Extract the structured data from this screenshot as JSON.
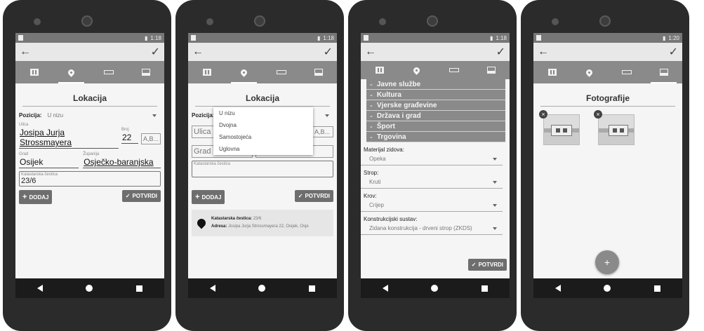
{
  "status": {
    "time1": "1:18",
    "time2": "1:18",
    "time3": "1:18",
    "time4": "1:20"
  },
  "icons": {
    "back": "←",
    "confirm": "✓"
  },
  "screen1": {
    "title": "Lokacija",
    "pozicija_label": "Pozicija:",
    "pozicija_value": "U nizu",
    "ulica_label": "Ulica",
    "broj_label": "Broj",
    "ulica_value": "Josipa Jurja Strossmayera",
    "broj_value": "22",
    "slovo_placeholder": "A,B...",
    "grad_label": "Grad",
    "zupanija_label": "Županija",
    "grad_value": "Osijek",
    "zupanija_value": "Osječko-baranjska",
    "katastarska_label": "Katastarska čestica",
    "katastarska_value": "23/6",
    "dodaj_label": "DODAJ",
    "potvrdi_label": "POTVRDI"
  },
  "screen2": {
    "title": "Lokacija",
    "pozicija_label": "Pozicija:",
    "options": [
      "U nizu",
      "Dvojna",
      "Samostojeća",
      "Uglovna"
    ],
    "ulica_placeholder": "Ulica",
    "slovo_placeholder": "A,B...",
    "grad_placeholder": "Grad",
    "katastarska_label": "Katastarska čestica",
    "dodaj_label": "DODAJ",
    "potvrdi_label": "POTVRDI",
    "card_kc_label": "Katastarska čestica:",
    "card_kc_value": "23/6",
    "card_adresa_label": "Adresa:",
    "card_adresa_value": "Josipa Jurja Strossmayera 22, Osijek, Osje"
  },
  "screen3": {
    "categories": [
      "Javne službe",
      "Kultura",
      "Vjerske građevine",
      "Država i grad",
      "Šport",
      "Trgovina"
    ],
    "q1": "Materijal zidova:",
    "a1": "Opeka",
    "q2": "Strop:",
    "a2": "Kruti",
    "q3": "Krov:",
    "a3": "Crijep",
    "q4": "Konstrukcijski sustav:",
    "a4": "Zidana konstrukcija - drveni strop (ZKDS)",
    "potvrdi_label": "POTVRDI"
  },
  "screen4": {
    "title": "Fotografije",
    "delete_icon": "×",
    "fab_icon": "+"
  }
}
